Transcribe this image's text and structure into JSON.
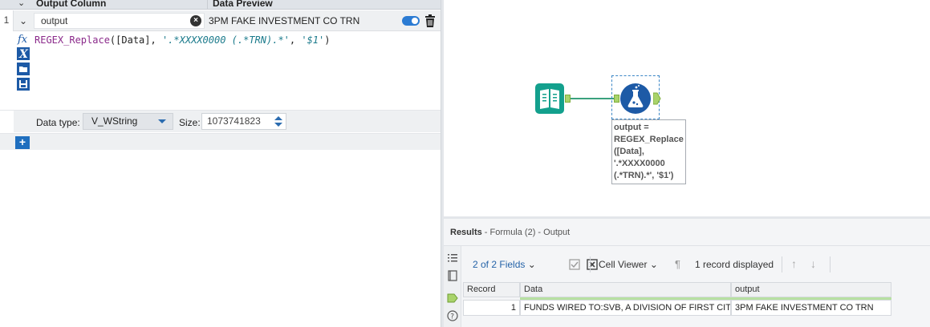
{
  "formula_panel": {
    "header": {
      "output_column": "Output Column",
      "data_preview": "Data Preview"
    },
    "row": {
      "index": "1",
      "output_name": "output",
      "preview": "3PM FAKE INVESTMENT CO TRN"
    },
    "expression": {
      "func": "REGEX_Replace",
      "open": "([Data], ",
      "pattern": "'.*XXXX0000 (.*TRN).*'",
      "comma": ", ",
      "replacement": "'$1'",
      "close": ")"
    },
    "data_type_label": "Data type:",
    "data_type_value": "V_WString",
    "size_label": "Size:",
    "size_value": "1073741823",
    "add_label": "+"
  },
  "canvas": {
    "annotation": [
      "output =",
      "REGEX_Replace",
      "([Data],",
      "'.*XXXX0000",
      "(.*TRN).*', '$1')"
    ]
  },
  "results": {
    "title_bold": "Results",
    "title_rest": " - Formula (2) - Output",
    "fields_label": "2 of 2 Fields",
    "cell_viewer_label": "Cell Viewer",
    "record_count": "1 record displayed",
    "columns": [
      "Record",
      "Data",
      "output"
    ],
    "rows": [
      {
        "record": "1",
        "data": "FUNDS WIRED TO:SVB, A DIVISION OF FIRST CITI...",
        "output": "3PM FAKE INVESTMENT CO TRN"
      }
    ]
  },
  "colors": {
    "accent_blue": "#1f6fbf",
    "tool_teal": "#13a08d",
    "formula_blue": "#1d5aa6",
    "anchor_green": "#a9d36b"
  }
}
